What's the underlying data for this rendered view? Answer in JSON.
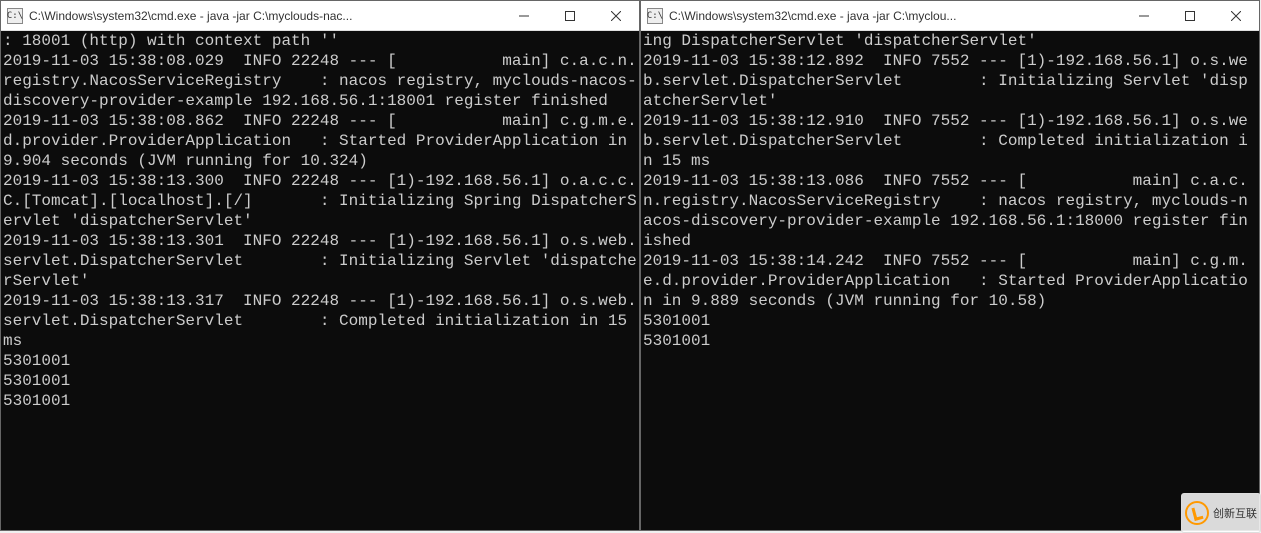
{
  "leftWindow": {
    "title": "C:\\Windows\\system32\\cmd.exe - java  -jar C:\\myclouds-nac...",
    "iconLabel": "C:\\",
    "console": ": 18001 (http) with context path ''\n2019-11-03 15:38:08.029  INFO 22248 --- [           main] c.a.c.n.registry.NacosServiceRegistry    : nacos registry, myclouds-nacos-discovery-provider-example 192.168.56.1:18001 register finished\n2019-11-03 15:38:08.862  INFO 22248 --- [           main] c.g.m.e.d.provider.ProviderApplication   : Started ProviderApplication in 9.904 seconds (JVM running for 10.324)\n2019-11-03 15:38:13.300  INFO 22248 --- [1)-192.168.56.1] o.a.c.c.C.[Tomcat].[localhost].[/]       : Initializing Spring DispatcherServlet 'dispatcherServlet'\n2019-11-03 15:38:13.301  INFO 22248 --- [1)-192.168.56.1] o.s.web.servlet.DispatcherServlet        : Initializing Servlet 'dispatcherServlet'\n2019-11-03 15:38:13.317  INFO 22248 --- [1)-192.168.56.1] o.s.web.servlet.DispatcherServlet        : Completed initialization in 15 ms\n5301001\n5301001\n5301001"
  },
  "rightWindow": {
    "title": "C:\\Windows\\system32\\cmd.exe - java  -jar C:\\myclou...",
    "iconLabel": "C:\\",
    "console": "ing DispatcherServlet 'dispatcherServlet'\n2019-11-03 15:38:12.892  INFO 7552 --- [1)-192.168.56.1] o.s.web.servlet.DispatcherServlet        : Initializing Servlet 'dispatcherServlet'\n2019-11-03 15:38:12.910  INFO 7552 --- [1)-192.168.56.1] o.s.web.servlet.DispatcherServlet        : Completed initialization in 15 ms\n2019-11-03 15:38:13.086  INFO 7552 --- [           main] c.a.c.n.registry.NacosServiceRegistry    : nacos registry, myclouds-nacos-discovery-provider-example 192.168.56.1:18000 register finished\n2019-11-03 15:38:14.242  INFO 7552 --- [           main] c.g.m.e.d.provider.ProviderApplication   : Started ProviderApplication in 9.889 seconds (JVM running for 10.58)\n5301001\n5301001"
  },
  "watermark": {
    "text": "创新互联"
  }
}
